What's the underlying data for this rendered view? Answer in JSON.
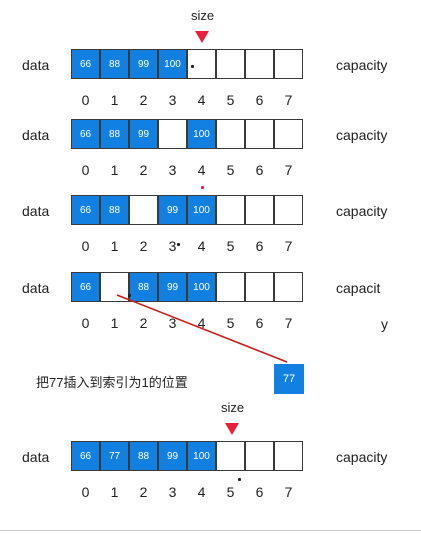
{
  "size_label": "size",
  "data_label": "data",
  "capacity_label": "capacity",
  "capacity_cut_label": "capacit",
  "capacity_tail_label": "y",
  "indices": [
    "0",
    "1",
    "2",
    "3",
    "4",
    "5",
    "6",
    "7"
  ],
  "rows": [
    [
      "66",
      "88",
      "99",
      "100",
      "",
      "",
      "",
      ""
    ],
    [
      "66",
      "88",
      "99",
      "",
      "100",
      "",
      "",
      ""
    ],
    [
      "66",
      "88",
      "",
      "99",
      "100",
      "",
      "",
      ""
    ],
    [
      "66",
      "",
      "88",
      "99",
      "100",
      "",
      "",
      ""
    ],
    [
      "66",
      "77",
      "88",
      "99",
      "100",
      "",
      "",
      ""
    ]
  ],
  "caption": "把77插入到索引为1的位置",
  "new_element": "77",
  "colors": {
    "cell_fill": "#1180e0",
    "marker": "#e8203a",
    "arrow": "#cc1e1e"
  }
}
